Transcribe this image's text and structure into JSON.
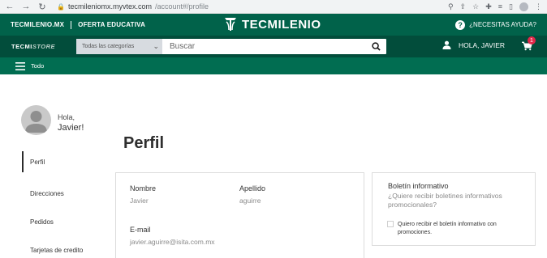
{
  "browser": {
    "url_host": "tecmileniomx.myvtex.com",
    "url_path": "/account#/profile"
  },
  "topbar": {
    "link1": "TECMILENIO.MX",
    "link2": "OFERTA EDUCATIVA",
    "brand": "TECMILENIO",
    "help": "¿NECESITAS AYUDA?"
  },
  "storebar": {
    "store_a": "TECMI",
    "store_b": "STORE",
    "category": "Todas las categorías",
    "search_placeholder": "Buscar",
    "user": "HOLA, JAVIER",
    "cart_count": "1"
  },
  "menubar": {
    "label": "Todo"
  },
  "account": {
    "greeting": "Hola,",
    "name": "Javier!",
    "title": "Perfil",
    "menu": [
      {
        "label": "Perfil"
      },
      {
        "label": "Direcciones"
      },
      {
        "label": "Pedidos"
      },
      {
        "label": "Tarjetas de credito"
      }
    ]
  },
  "profile": {
    "nombre_label": "Nombre",
    "nombre_value": "Javier",
    "apellido_label": "Apellido",
    "apellido_value": "aguirre",
    "email_label": "E-mail",
    "email_value": "javier.aguirre@isita.com.mx"
  },
  "newsletter": {
    "title": "Boletín informativo",
    "description": "¿Quiere recibir boletines informativos promocionales?",
    "checkbox_label": "Quiero recibir el boletín informativo con promociones."
  }
}
